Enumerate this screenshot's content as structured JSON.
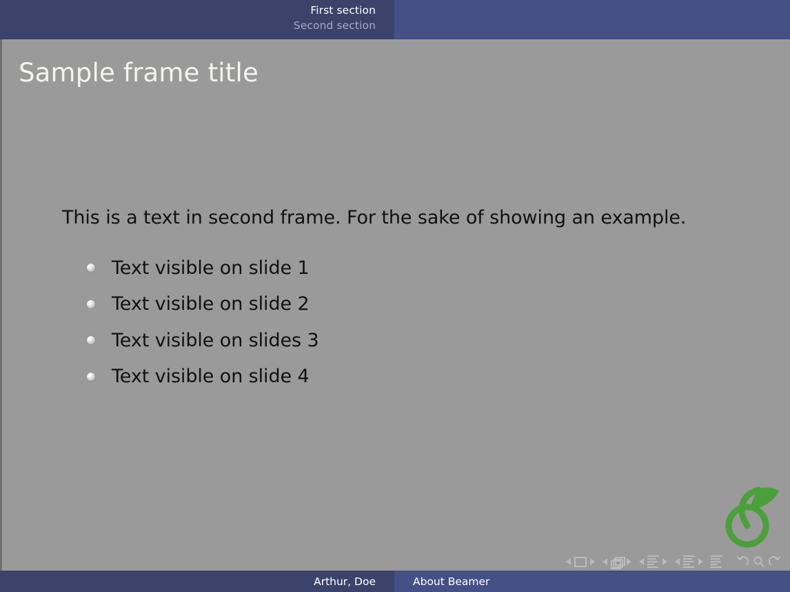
{
  "header": {
    "sections": [
      {
        "label": "First section",
        "state": "active"
      },
      {
        "label": "Second section",
        "state": "inactive"
      }
    ]
  },
  "slide": {
    "title": "Sample frame title",
    "paragraph": "This is a text in second frame.  For the sake of showing an example.",
    "items": [
      {
        "label": "Text visible on slide 1"
      },
      {
        "label": "Text visible on slide 2"
      },
      {
        "label": "Text visible on slides 3"
      },
      {
        "label": "Text visible on slide 4"
      }
    ]
  },
  "logo": {
    "name": "green-sprout-logo",
    "color": "#4ba03b"
  },
  "navigation_symbols": {
    "groups": [
      {
        "name": "slide-navigation",
        "icon": "slide-icon"
      },
      {
        "name": "frame-navigation",
        "icon": "frame-stack-icon"
      },
      {
        "name": "subsection-navigation",
        "icon": "subsection-lines-icon"
      },
      {
        "name": "section-navigation",
        "icon": "section-lines-icon"
      },
      {
        "name": "presentation-navigation",
        "icon": "presentation-lines-icon"
      }
    ],
    "extra": [
      {
        "name": "back-button",
        "icon": "undo-arrow-icon"
      },
      {
        "name": "find-button",
        "icon": "magnifier-icon"
      },
      {
        "name": "forward-button",
        "icon": "redo-arrow-icon"
      }
    ]
  },
  "footer": {
    "author": "Arthur, Doe",
    "presentation_title": "About Beamer"
  },
  "colors": {
    "header_left": "#3b436b",
    "header_right": "#445086",
    "background": "#9a9a9a",
    "title_text": "#f5f3f0",
    "body_text": "#111111",
    "inactive_section": "#a4a9c4",
    "logo_green": "#4ba03b"
  }
}
